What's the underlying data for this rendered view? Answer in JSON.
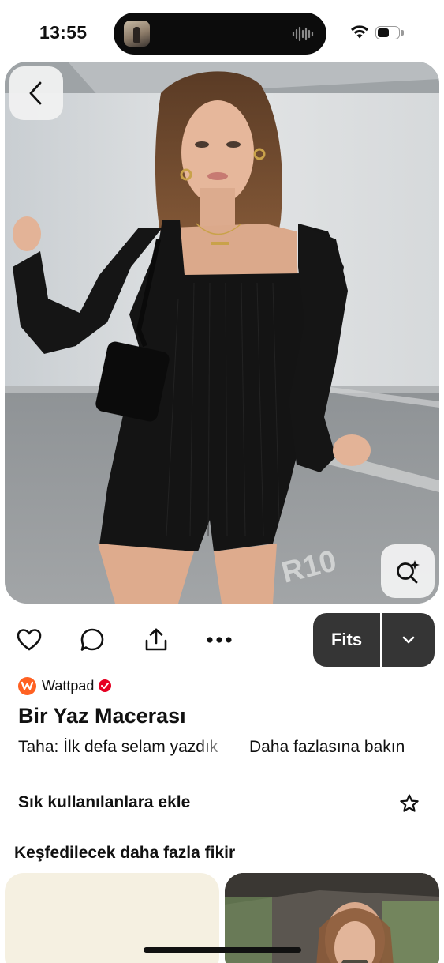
{
  "status_bar": {
    "time": "13:55",
    "battery_level": 0.55,
    "icons": [
      "now-playing-thumbnail",
      "audio-waveform-icon",
      "wifi-icon",
      "battery-icon"
    ]
  },
  "pin": {
    "image_description_icon": "photo",
    "back_icon": "chevron-left-icon",
    "visual_search_icon": "visual-search-sparkle-icon"
  },
  "actions": {
    "icons": [
      "heart-icon",
      "comment-icon",
      "share-icon",
      "more-icon"
    ],
    "fits_label": "Fits",
    "fits_dropdown_icon": "chevron-down-icon"
  },
  "source": {
    "name": "Wattpad",
    "verified": true
  },
  "title": "Bir Yaz Macerası",
  "description": "Taha: İlk defa selam yazdık",
  "see_more": "Daha fazlasına bakın",
  "board": {
    "label": "Sık kullanılanlara ekle",
    "icon": "star-outline-icon"
  },
  "more_ideas": {
    "heading": "Keşfedilecek daha fazla fikir"
  },
  "colors": {
    "fits_button_bg": "#353535",
    "wattpad_orange": "#ff6122",
    "verified_red": "#e60023"
  }
}
